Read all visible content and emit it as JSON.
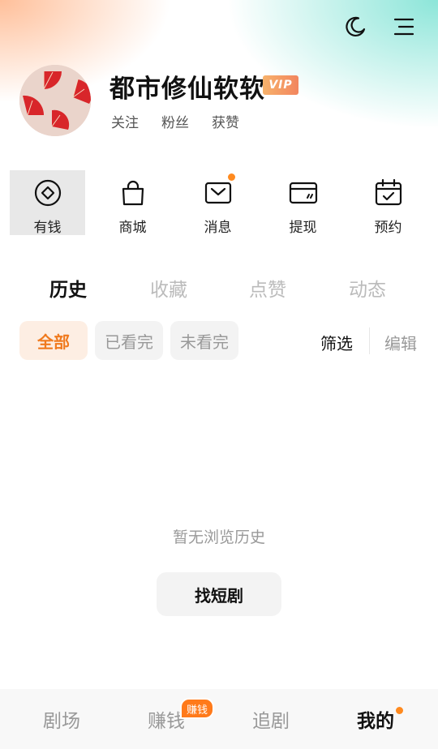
{
  "profile": {
    "name": "都市修仙软软",
    "vip_label": "VIP",
    "stats": [
      "关注",
      "粉丝",
      "获赞"
    ]
  },
  "quick_actions": [
    {
      "label": "有钱",
      "icon": "coin-icon",
      "active": true
    },
    {
      "label": "商城",
      "icon": "shopping-bag-icon",
      "active": false
    },
    {
      "label": "消息",
      "icon": "envelope-icon",
      "dot": true
    },
    {
      "label": "提现",
      "icon": "wallet-icon",
      "active": false
    },
    {
      "label": "预约",
      "icon": "calendar-check-icon",
      "active": false
    }
  ],
  "tabs": [
    "历史",
    "收藏",
    "点赞",
    "动态"
  ],
  "active_tab": "历史",
  "filters": {
    "chips": [
      "全部",
      "已看完",
      "未看完"
    ],
    "active_chip": "全部",
    "filter_label": "筛选",
    "edit_label": "编辑"
  },
  "empty_state": {
    "message": "暂无浏览历史",
    "button_label": "找短剧"
  },
  "bottom_nav": {
    "items": [
      "剧场",
      "赚钱",
      "追剧",
      "我的"
    ],
    "active": "我的",
    "earn_badge": "赚钱"
  },
  "colors": {
    "accent": "#f07a1e",
    "dot": "#ff8a1f",
    "vip_gradient": [
      "#f7b26b",
      "#f2855e"
    ]
  }
}
